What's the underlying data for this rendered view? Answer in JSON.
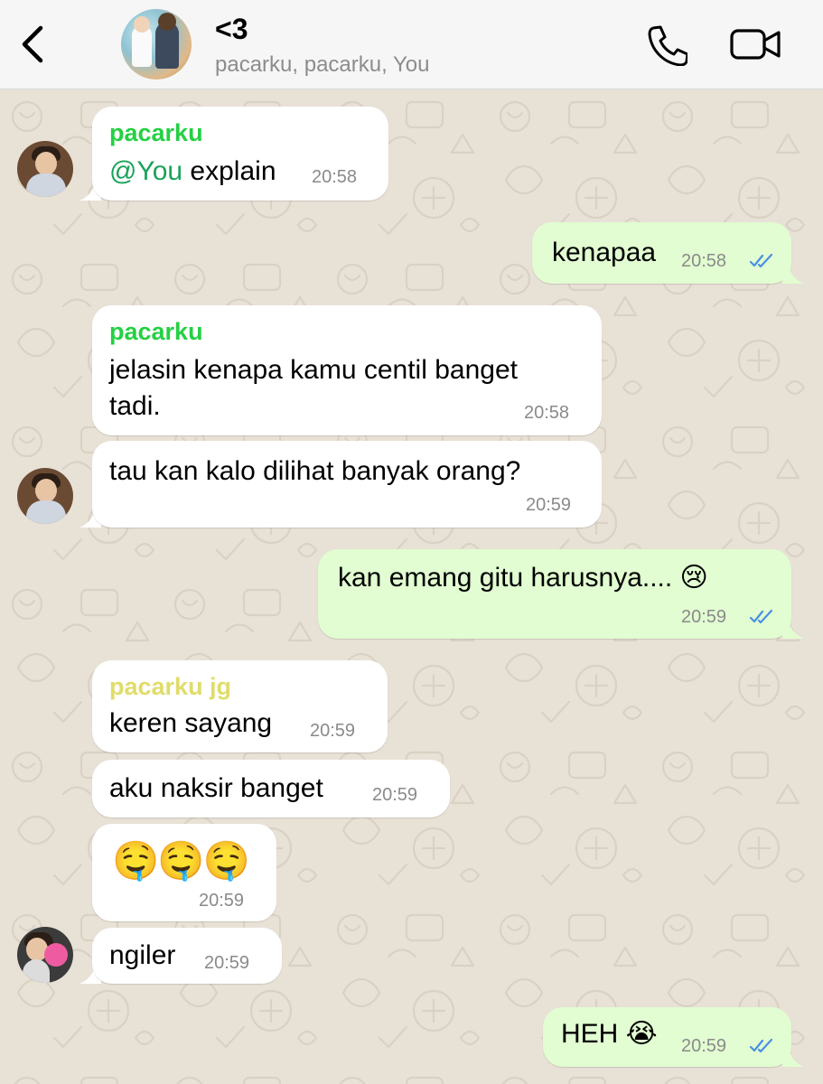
{
  "header": {
    "title": "<3",
    "subtitle": "pacarku, pacarku, You"
  },
  "colors": {
    "incoming_bubble": "#ffffff",
    "outgoing_bubble": "#e1fdd1",
    "sender_green": "#25d043",
    "sender_yellow": "#e0dc6a",
    "read_ticks": "#4a90e2",
    "header_bg": "#f6f6f6",
    "wallpaper": "#e8e1d6"
  },
  "messages": [
    {
      "direction": "in",
      "sender": "pacarku",
      "mention": "@You",
      "text": " explain",
      "time": "20:58"
    },
    {
      "direction": "out",
      "text": "kenapaa",
      "time": "20:58"
    },
    {
      "direction": "in",
      "sender": "pacarku",
      "line1": "jelasin kenapa kamu centil banget",
      "line2": "tadi.",
      "time": "20:58"
    },
    {
      "direction": "in",
      "text": "tau kan kalo dilihat banyak orang?",
      "time": "20:59"
    },
    {
      "direction": "out",
      "text": "kan emang gitu harusnya.... 😢",
      "time": "20:59"
    },
    {
      "direction": "in",
      "sender": "pacarku jg",
      "text": "keren sayang",
      "time": "20:59"
    },
    {
      "direction": "in",
      "text": "aku naksir banget",
      "time": "20:59"
    },
    {
      "direction": "in",
      "text": "🤤🤤🤤",
      "time": "20:59"
    },
    {
      "direction": "in",
      "text": "ngiler",
      "time": "20:59"
    },
    {
      "direction": "out",
      "text": "HEH 😭",
      "time": "20:59"
    }
  ]
}
